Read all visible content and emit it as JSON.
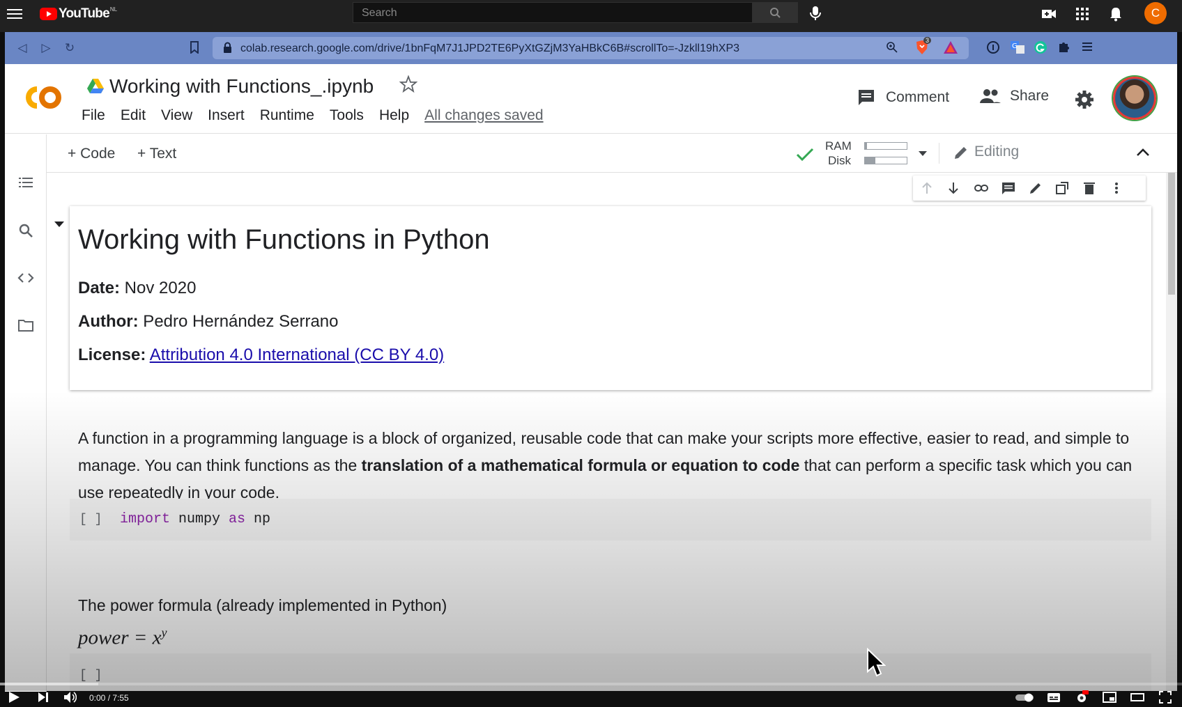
{
  "youtube": {
    "logo_text": "YouTube",
    "country_code": "NL",
    "search_placeholder": "Search",
    "avatar_letter": "C"
  },
  "browser": {
    "url": "colab.research.google.com/drive/1bnFqM7J1JPD2TE6PyXtGZjM3YaHBkC6B#scrollTo=-Jzkll19hXP3",
    "brave_badge_count": "3"
  },
  "colab": {
    "title": "Working with Functions_.ipynb",
    "menu": [
      "File",
      "Edit",
      "View",
      "Insert",
      "Runtime",
      "Tools",
      "Help"
    ],
    "save_status": "All changes saved",
    "comment_label": "Comment",
    "share_label": "Share",
    "toolbar": {
      "add_code": "+ Code",
      "add_text": "+ Text",
      "ram_label": "RAM",
      "disk_label": "Disk",
      "ram_usage": 0.05,
      "disk_usage": 0.25,
      "editing_label": "Editing"
    }
  },
  "notebook": {
    "heading": "Working with Functions in Python",
    "date_label": "Date:",
    "date_value": " Nov 2020",
    "author_label": "Author:",
    "author_value": " Pedro Hernández Serrano",
    "license_label": "License:",
    "license_link": "Attribution 4.0 International (CC BY 4.0)",
    "intro_part1": "A function in a programming language is a block of organized, reusable code that can make your scripts more effective, easier to read, and simple to manage. You can think functions as the ",
    "intro_bold": "translation of a mathematical formula or equation to code",
    "intro_part2": " that can perform a specific task which you can use repeatedly in your code.",
    "code1_bracket": "[ ]",
    "code1_kw1": "import",
    "code1_mod": " numpy ",
    "code1_kw2": "as",
    "code1_alias": " np",
    "power_text": "The power formula (already implemented in Python)",
    "formula_lhs": "power = x",
    "formula_sup": "y",
    "code2_bracket": "[ ]"
  },
  "video": {
    "timecode": "0:00 / 7:55",
    "played_fraction": 0.0,
    "buffered_fraction": 0.083
  }
}
